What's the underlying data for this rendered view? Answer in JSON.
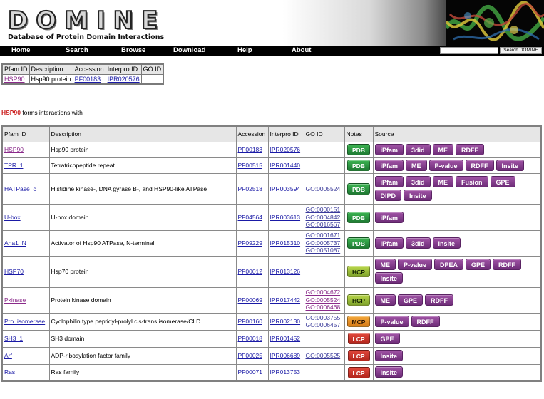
{
  "logo": {
    "title": "DOMINE",
    "subtitle": "Database of Protein Domain Interactions"
  },
  "nav": {
    "items": [
      "Home",
      "Search",
      "Browse",
      "Download",
      "Help",
      "About"
    ],
    "search_button": "Search DOMINE",
    "search_value": ""
  },
  "query": {
    "headers": [
      "Pfam ID",
      "Description",
      "Accession",
      "Interpro ID",
      "GO ID"
    ],
    "row": {
      "pfam_id": "HSP90",
      "description": "Hsp90 protein",
      "accession": "PF00183",
      "interpro_id": "IPR020576",
      "go_id": ""
    }
  },
  "forms_line": {
    "pfam": "HSP90",
    "text": "forms interactions with"
  },
  "results": {
    "headers": [
      "Pfam ID",
      "Description",
      "Accession",
      "Interpro ID",
      "GO ID",
      "Notes",
      "Source"
    ],
    "rows": [
      {
        "pfam_id": "HSP90",
        "description": "Hsp90 protein",
        "accession": "PF00183",
        "interpro_id": "IPR020576",
        "go_ids": [],
        "note": "PDB",
        "sources": [
          "iPfam",
          "3did",
          "ME",
          "RDFF"
        ]
      },
      {
        "pfam_id": "TPR_1",
        "description": "Tetratricopeptide repeat",
        "accession": "PF00515",
        "interpro_id": "IPR001440",
        "go_ids": [],
        "note": "PDB",
        "sources": [
          "iPfam",
          "ME",
          "P-value",
          "RDFF",
          "Insite"
        ]
      },
      {
        "pfam_id": "HATPase_c",
        "description": "Histidine kinase-, DNA gyrase B-, and HSP90-like ATPase",
        "accession": "PF02518",
        "interpro_id": "IPR003594",
        "go_ids": [
          "GO:0005524"
        ],
        "note": "PDB",
        "sources": [
          "iPfam",
          "3did",
          "ME",
          "Fusion",
          "GPE",
          "DIPD",
          "Insite"
        ]
      },
      {
        "pfam_id": "U-box",
        "description": "U-box domain",
        "accession": "PF04564",
        "interpro_id": "IPR003613",
        "go_ids": [
          "GO:0000151",
          "GO:0004842",
          "GO:0016567"
        ],
        "note": "PDB",
        "sources": [
          "iPfam"
        ]
      },
      {
        "pfam_id": "Aha1_N",
        "description": "Activator of Hsp90 ATPase, N-terminal",
        "accession": "PF09229",
        "interpro_id": "IPR015310",
        "go_ids": [
          "GO:0001671",
          "GO:0005737",
          "GO:0051087"
        ],
        "note": "PDB",
        "sources": [
          "iPfam",
          "3did",
          "Insite"
        ]
      },
      {
        "pfam_id": "HSP70",
        "description": "Hsp70 protein",
        "accession": "PF00012",
        "interpro_id": "IPR013126",
        "go_ids": [],
        "note": "HCP",
        "sources": [
          "ME",
          "P-value",
          "DPEA",
          "GPE",
          "RDFF",
          "Insite"
        ]
      },
      {
        "pfam_id": "Pkinase",
        "description": "Protein kinase domain",
        "accession": "PF00069",
        "interpro_id": "IPR017442",
        "go_ids": [
          "GO:0004672",
          "GO:0005524",
          "GO:0006468"
        ],
        "note": "HCP",
        "sources": [
          "ME",
          "GPE",
          "RDFF"
        ]
      },
      {
        "pfam_id": "Pro_isomerase",
        "description": "Cyclophilin type peptidyl-prolyl cis-trans isomerase/CLD",
        "accession": "PF00160",
        "interpro_id": "IPR002130",
        "go_ids": [
          "GO:0003755",
          "GO:0006457"
        ],
        "note": "MCP",
        "sources": [
          "P-value",
          "RDFF"
        ]
      },
      {
        "pfam_id": "SH3_1",
        "description": "SH3 domain",
        "accession": "PF00018",
        "interpro_id": "IPR001452",
        "go_ids": [],
        "note": "LCP",
        "sources": [
          "GPE"
        ]
      },
      {
        "pfam_id": "Arf",
        "description": "ADP-ribosylation factor family",
        "accession": "PF00025",
        "interpro_id": "IPR006689",
        "go_ids": [
          "GO:0005525"
        ],
        "note": "LCP",
        "sources": [
          "Insite"
        ]
      },
      {
        "pfam_id": "Ras",
        "description": "Ras family",
        "accession": "PF00071",
        "interpro_id": "IPR013753",
        "go_ids": [],
        "note": "LCP",
        "sources": [
          "Insite"
        ]
      }
    ]
  }
}
